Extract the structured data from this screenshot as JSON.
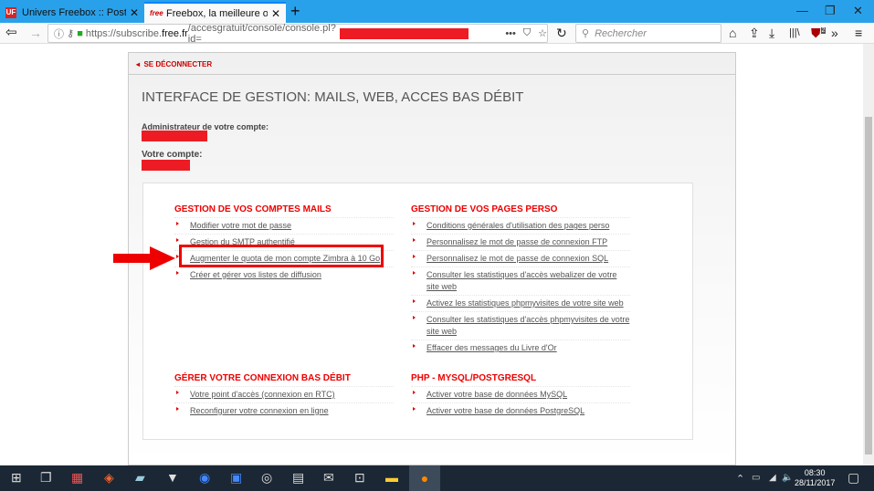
{
  "browser": {
    "tabs": [
      {
        "label": "Univers Freebox :: Poster une ré",
        "favicon": "UF"
      },
      {
        "label": "Freebox, la meilleure offre ADSL",
        "favicon": "free"
      }
    ],
    "url_prefix": "https://subscribe.",
    "url_domain": "free.fr",
    "url_path": "/accesgratuit/console/console.pl?id=",
    "search_placeholder": "Rechercher",
    "badge_count": "2"
  },
  "page": {
    "logout": "SE DÉCONNECTER",
    "title": "INTERFACE DE GESTION: MAILS, WEB, ACCES BAS DÉBIT",
    "admin_label": "Administrateur de votre compte:",
    "account_label": "Votre compte:",
    "sections": [
      {
        "title": "GESTION DE VOS COMPTES MAILS",
        "links": [
          "Modifier votre mot de passe",
          "Gestion du SMTP authentifié",
          "Augmenter le quota de mon compte Zimbra à 10 Go",
          "Créer et gérer vos listes de diffusion"
        ]
      },
      {
        "title": "GESTION DE VOS PAGES PERSO",
        "links": [
          "Conditions générales d'utilisation des pages perso",
          "Personnalisez le mot de passe de connexion FTP",
          "Personnalisez le mot de passe de connexion SQL",
          "Consulter les statistiques d'accès webalizer de votre site web",
          "Activez les statistiques phpmyvisites de votre site web",
          "Consulter les statistiques d'accès phpmyvisites de votre site web",
          "Effacer des messages du Livre d'Or"
        ]
      },
      {
        "title": "GÉRER VOTRE CONNEXION BAS DÉBIT",
        "links": [
          "Votre point d'accès (connexion en RTC)",
          "Reconfigurer votre connexion en ligne"
        ]
      },
      {
        "title": "PHP - MYSQL/POSTGRESQL",
        "links": [
          "Activer votre base de données MySQL",
          "Activer votre base de données PostgreSQL"
        ]
      }
    ]
  },
  "taskbar": {
    "time": "08:30",
    "date": "28/11/2017"
  },
  "colors": {
    "accent": "#e00000",
    "redaction": "#ed1c24",
    "tabbar": "#29a1ea"
  }
}
